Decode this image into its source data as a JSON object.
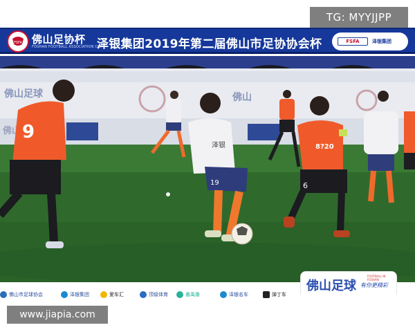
{
  "watermark_top": "TG: MYYJJPP",
  "banner": {
    "logo_text": "FSFA",
    "association_name": "佛山足协杯",
    "association_sub": "FOSHAN FOOTBALL ASSOCIATION CUP",
    "event_title": "泽银集团2019年第二届佛山市足协协会杯",
    "right_logo_1": "FSFA",
    "right_logo_2": "泽银集团"
  },
  "scene": {
    "description": "football match at night",
    "player_numbers": [
      "9",
      "19",
      "6"
    ],
    "sign_texts": [
      "佛山足球",
      "佛山",
      "佛山足球"
    ],
    "shirt_text": "泽银"
  },
  "sponsors": [
    {
      "label": "佛山市足球协会",
      "icon_color": "#2b6fb6"
    },
    {
      "label": "泽银集团",
      "icon_color": "#1a8ad0"
    },
    {
      "label": "爱车汇",
      "icon_color": "#f2b600"
    },
    {
      "label": "顶级体育",
      "icon_color": "#2a6cc4"
    },
    {
      "label": "番禺番",
      "icon_color": "#2ab29a"
    },
    {
      "label": "泽银名车",
      "icon_color": "#1a8ad0"
    },
    {
      "label": "弹丁车",
      "icon_color": "#222222"
    }
  ],
  "footer_brand": {
    "title": "佛山足球",
    "tagline": "有你更精彩",
    "small": "FOOTBALL IN FOSHAN"
  },
  "watermark_bottom": "www.jiapia.com",
  "colors": {
    "banner_blue": "#15389a",
    "orange_kit": "#f05a2a",
    "white_kit": "#f2f2f5",
    "pitch": "#2f6a2c"
  }
}
